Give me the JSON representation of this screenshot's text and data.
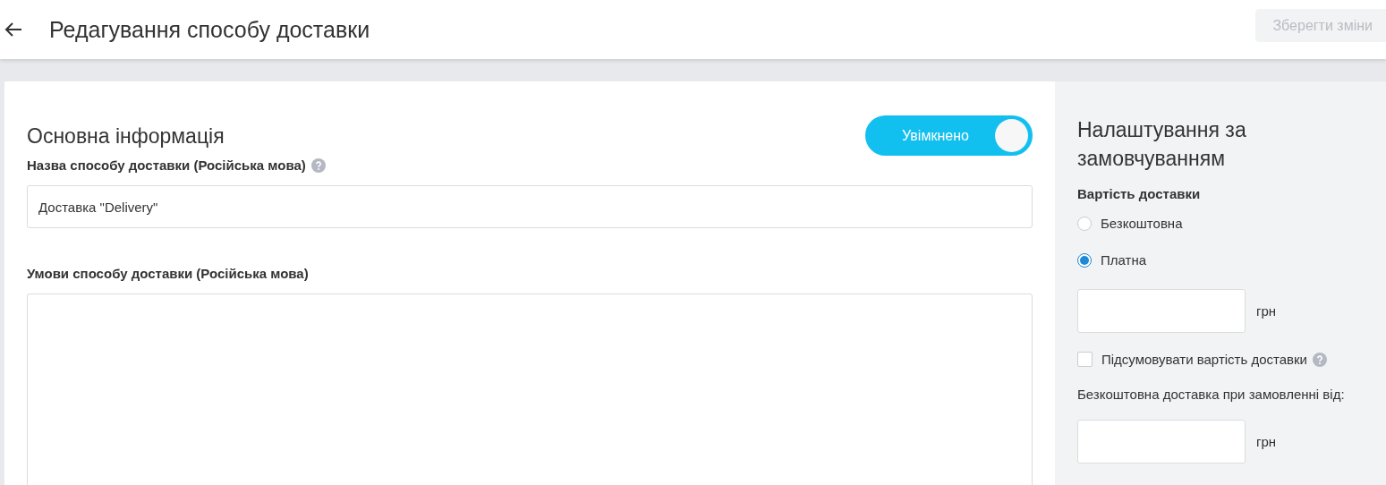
{
  "header": {
    "title": "Редагування способу доставки",
    "save_button": {
      "label": "Зберегти зміни",
      "disabled": true
    }
  },
  "main": {
    "heading": "Основна інформація",
    "toggle": {
      "label": "Увімкнено",
      "on": true
    },
    "name_field": {
      "label": "Назва способу доставки (Російська мова)",
      "value": "Доставка \"Delivery\""
    },
    "conditions_field": {
      "label": "Умови способу доставки (Російська мова)"
    }
  },
  "defaults": {
    "heading": "Налаштування за замовчуванням",
    "cost_label": "Вартість доставки",
    "cost_options": [
      {
        "label": "Безкоштовна",
        "selected": false
      },
      {
        "label": "Платна",
        "selected": true
      }
    ],
    "price_unit": "грн",
    "sum_checkbox": {
      "label": "Підсумовувати вартість доставки",
      "checked": false
    },
    "free_from_label": "Безкоштовна доставка при замовленні від:",
    "free_from_unit": "грн"
  }
}
